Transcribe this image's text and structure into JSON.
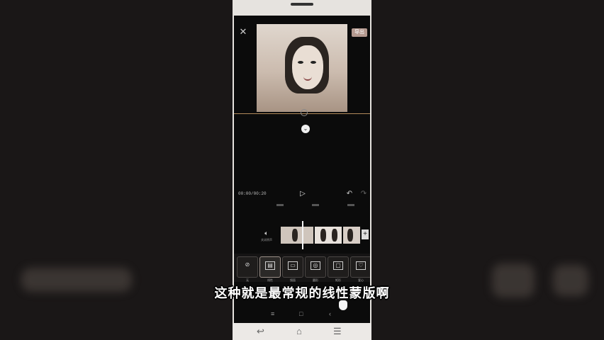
{
  "editor": {
    "close_icon": "close-icon",
    "export_label": "导出",
    "expand_icon": "chevron-down-icon",
    "timecode": "00:00/00:20",
    "play_icon": "play-icon",
    "undo_icon": "undo-icon",
    "redo_icon": "redo-icon"
  },
  "timeline": {
    "mute_label": "关闭原声",
    "add_icon": "plus-icon"
  },
  "mask_tools": [
    {
      "name": "none",
      "label": "无",
      "glyph": "⊘"
    },
    {
      "name": "linear",
      "label": "线性",
      "glyph": "▤"
    },
    {
      "name": "mirror",
      "label": "镜面",
      "glyph": "▭"
    },
    {
      "name": "circle",
      "label": "圆形",
      "glyph": "◎"
    },
    {
      "name": "rectangle",
      "label": "矩形",
      "glyph": "▢"
    },
    {
      "name": "heart",
      "label": "爱心",
      "glyph": "♡"
    }
  ],
  "subtitle": "这种就是最常规的线性蒙版啊",
  "inner_nav": {
    "menu": "≡",
    "home": "□",
    "back": "‹"
  },
  "system_nav": {
    "back": "↩",
    "home": "⌂",
    "menu": "☰"
  }
}
